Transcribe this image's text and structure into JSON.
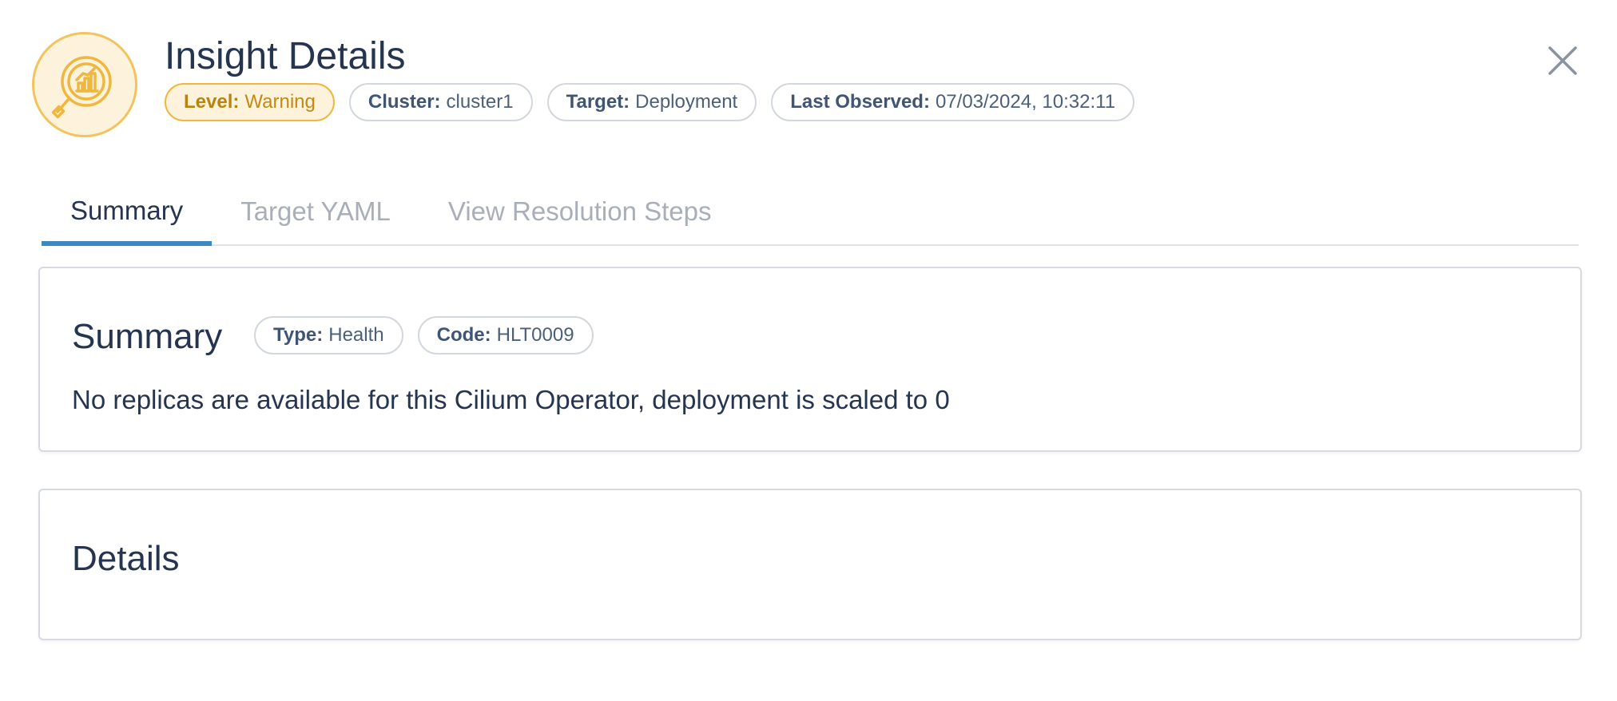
{
  "header": {
    "title": "Insight Details",
    "icon": "insight-chart-magnifier-icon",
    "badges": [
      {
        "key": "Level:",
        "value": "Warning"
      },
      {
        "key": "Cluster:",
        "value": "cluster1"
      },
      {
        "key": "Target:",
        "value": "Deployment"
      },
      {
        "key": "Last Observed:",
        "value": "07/03/2024, 10:32:11"
      }
    ],
    "close_icon": "close-icon"
  },
  "tabs": [
    {
      "label": "Summary",
      "active": true
    },
    {
      "label": "Target YAML",
      "active": false
    },
    {
      "label": "View Resolution Steps",
      "active": false
    }
  ],
  "summary": {
    "title": "Summary",
    "badges": [
      {
        "key": "Type:",
        "value": "Health"
      },
      {
        "key": "Code:",
        "value": "HLT0009"
      }
    ],
    "text": "No replicas are available for this Cilium Operator, deployment is scaled to 0"
  },
  "details": {
    "title": "Details"
  },
  "colors": {
    "accent": "#3b88c3",
    "warning": "#f0b73f",
    "text": "#25344f"
  }
}
